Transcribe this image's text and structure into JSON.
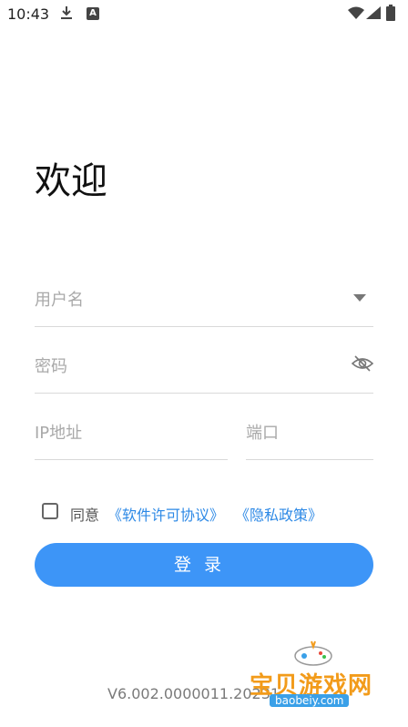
{
  "status_bar": {
    "time": "10:43",
    "icons": [
      "download-icon",
      "a-notification-icon",
      "wifi-icon",
      "signal-icon",
      "battery-icon"
    ]
  },
  "welcome_title": "欢迎",
  "login_form": {
    "username_placeholder": "用户名",
    "password_placeholder": "密码",
    "ip_placeholder": "IP地址",
    "port_placeholder": "端口",
    "agree_text": "同意",
    "license_link": "《软件许可协议》",
    "privacy_link": "《隐私政策》",
    "login_button": "登录",
    "agreement_checked": false
  },
  "version": "V6.002.0000011.20231",
  "watermark": {
    "text": "宝贝游戏网",
    "url": "baobeiy.com"
  },
  "colors": {
    "accent": "#3d95f7",
    "link": "#2d89e6",
    "watermark": "#f29b1a"
  }
}
